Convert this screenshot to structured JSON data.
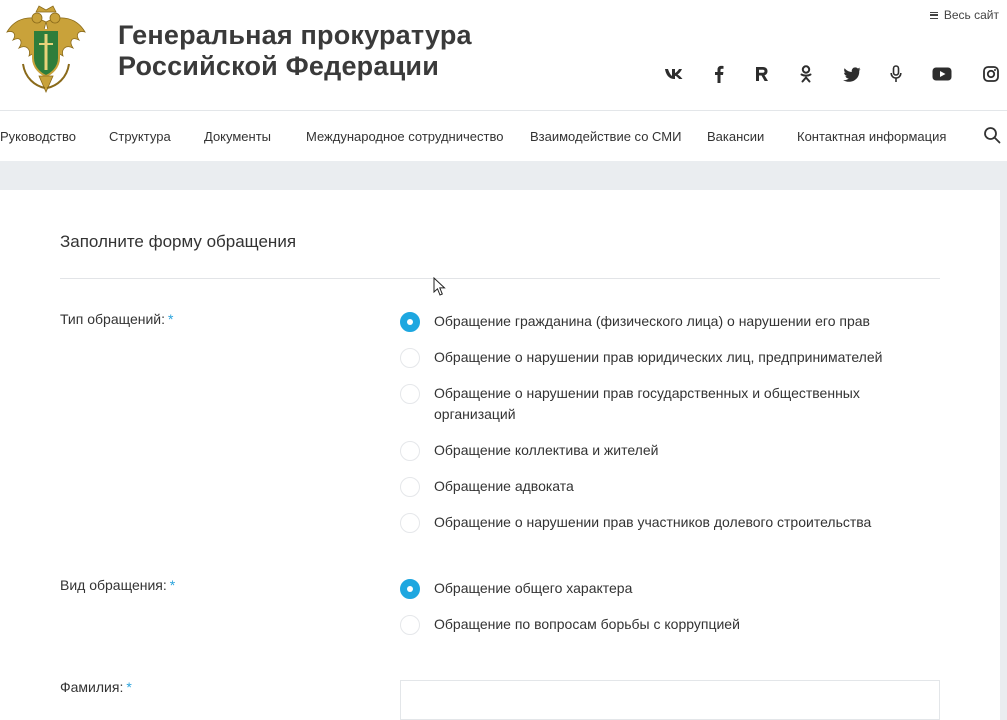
{
  "header": {
    "title_line1": "Генеральная прокуратура",
    "title_line2": "Российской Федерации",
    "all_site_label": "Весь сайт",
    "socials": [
      "vk-icon",
      "facebook-icon",
      "rutube-icon",
      "odnoklassniki-icon",
      "twitter-icon",
      "podcast-icon",
      "youtube-icon",
      "instagram-icon"
    ]
  },
  "nav": {
    "items": [
      "Руководство",
      "Структура",
      "Документы",
      "Международное сотрудничество",
      "Взаимодействие со СМИ",
      "Вакансии",
      "Контактная информация"
    ]
  },
  "form": {
    "title": "Заполните форму обращения",
    "required_mark": "*",
    "type_label": "Тип обращений:",
    "type_options": [
      "Обращение гражданина (физического лица) о нарушении его прав",
      "Обращение о нарушении прав юридических лиц, предпринимателей",
      "Обращение о нарушении прав государственных и общественных организаций",
      "Обращение коллектива и жителей",
      "Обращение адвоката",
      "Обращение о нарушении прав участников долевого строительства"
    ],
    "type_selected": 0,
    "kind_label": "Вид обращения:",
    "kind_options": [
      "Обращение общего характера",
      "Обращение по вопросам борьбы с коррупцией"
    ],
    "kind_selected": 0,
    "surname_label": "Фамилия:",
    "surname_value": ""
  },
  "colors": {
    "accent": "#1ea7e0",
    "background": "#eaedf0",
    "text": "#333333"
  }
}
